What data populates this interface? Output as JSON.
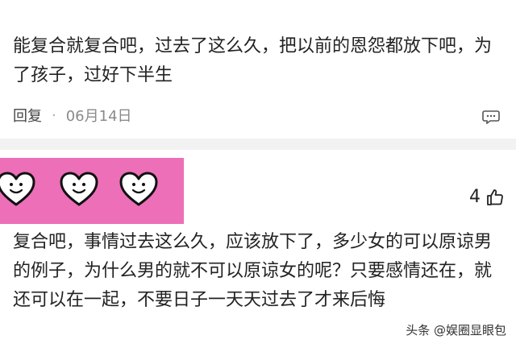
{
  "comment1": {
    "text": "能复合就复合吧，过去了这么久，把以前的恩怨都放下吧，为了孩子，过好下半生",
    "reply_label": "回复",
    "separator": "·",
    "date": "06月14日"
  },
  "sticker": {
    "background": "#ec6fb8",
    "icons": [
      "heart-smile-icon",
      "heart-smile-icon",
      "heart-smile-icon"
    ]
  },
  "comment2": {
    "like_count": "4",
    "text": "复合吧，事情过去这么久，应该放下了，多少女的可以原谅男的例子，为什么男的就不可以原谅女的呢？只要感情还在，就还可以在一起，不要日子一天天过去了才来后悔"
  },
  "watermark": {
    "text": "头条 @娱圈显眼包"
  }
}
